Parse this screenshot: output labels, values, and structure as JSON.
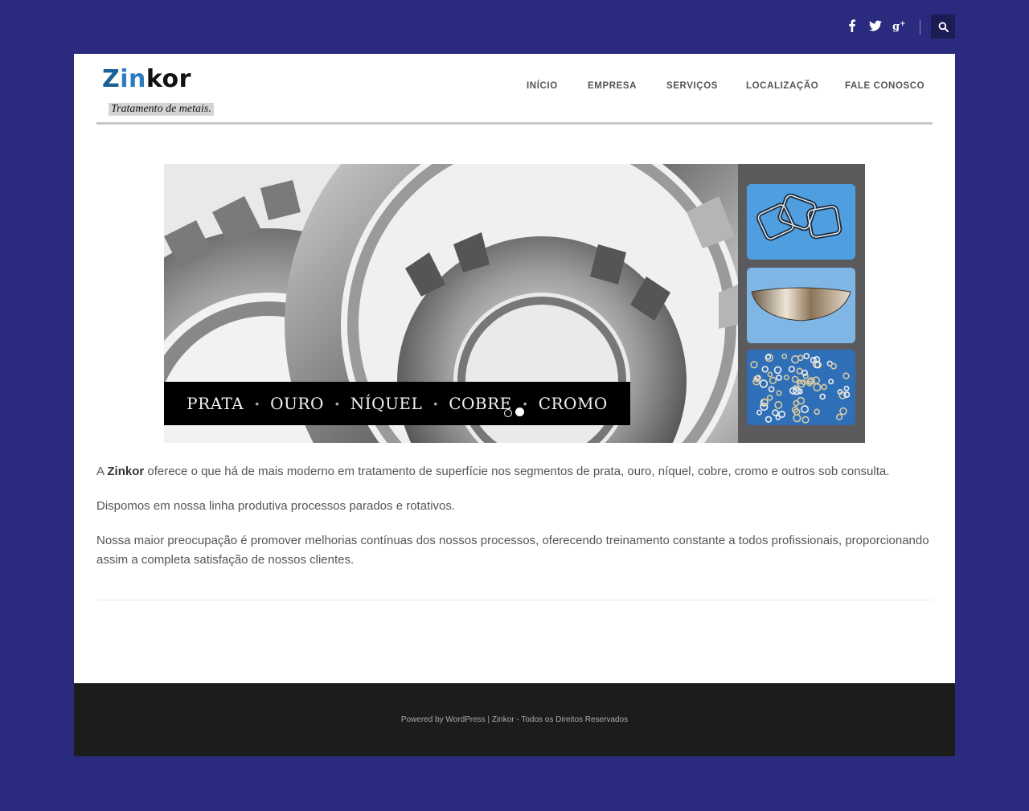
{
  "topbar": {
    "social": [
      {
        "name": "facebook-icon"
      },
      {
        "name": "twitter-icon"
      },
      {
        "name": "google-plus-icon"
      }
    ],
    "search_icon": "search-icon"
  },
  "header": {
    "logo": {
      "name_part1": "Z",
      "name_part2": "in",
      "name_part3": "kor",
      "tagline": "Tratamento de metais."
    },
    "nav": [
      {
        "label": "INÍCIO"
      },
      {
        "label": "EMPRESA"
      },
      {
        "label": "SERVIÇOS"
      },
      {
        "label": "LOCALIZAÇÃO"
      },
      {
        "label": "FALE CONOSCO"
      }
    ]
  },
  "slider": {
    "caption": [
      "PRATA",
      "OURO",
      "NÍQUEL",
      "COBRE",
      "CROMO"
    ],
    "separator": "•",
    "slide_count": 2,
    "active_slide": 2
  },
  "content": {
    "p1_prefix": "A ",
    "p1_brand": "Zinkor",
    "p1_rest": " oferece o que há de mais moderno em tratamento de superfície nos segmentos de prata, ouro, níquel, cobre, cromo e outros sob consulta.",
    "p2": "Dispomos em nossa linha produtiva processos parados e rotativos.",
    "p3": "Nossa maior preocupação é promover melhorias contínuas dos nossos processos, oferecendo treinamento constante a todos profissionais, proporcionando assim a completa satisfação de nossos clientes."
  },
  "footer": {
    "text": "Powered by WordPress | Zinkor - Todos os Direitos Reservados"
  },
  "colors": {
    "background": "#2a2a7e",
    "footer": "#1c1c1c",
    "logo_blue": "#1a5f96"
  }
}
